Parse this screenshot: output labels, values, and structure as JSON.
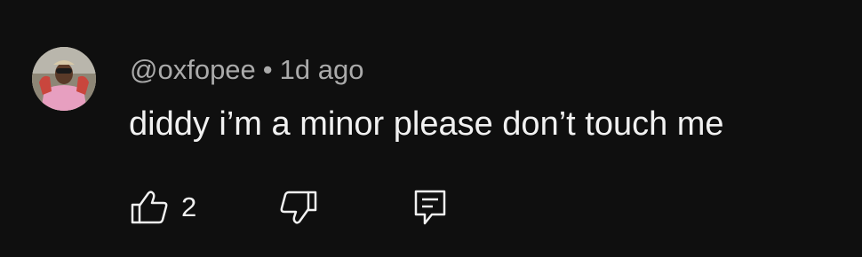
{
  "comment": {
    "handle": "@oxfopee",
    "separator": "•",
    "timestamp": "1d ago",
    "text": "diddy i’m a minor please don’t touch me",
    "like_count": "2"
  },
  "icons": {
    "like": "thumbs-up-icon",
    "dislike": "thumbs-down-icon",
    "reply": "reply-comment-icon"
  },
  "colors": {
    "background": "#0f0f0f",
    "primary_text": "#f1f1f1",
    "secondary_text": "#aaaaaa"
  }
}
